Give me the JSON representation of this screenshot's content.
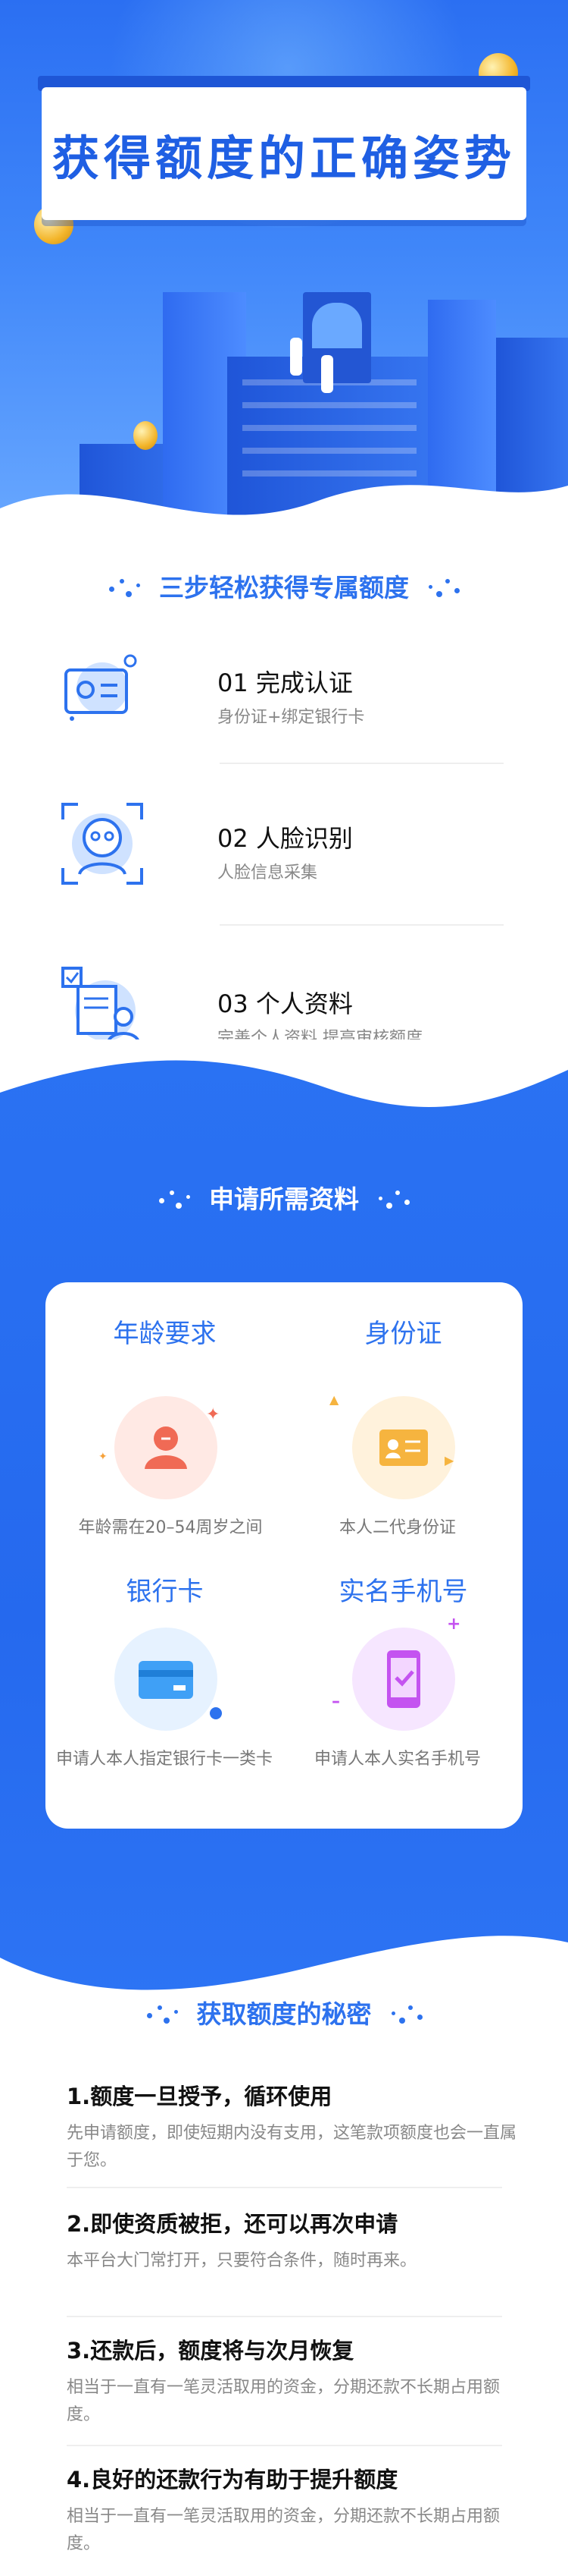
{
  "hero": {
    "title": "获得额度的正确姿势"
  },
  "steps_section": {
    "title": "三步轻松获得专属额度",
    "steps": [
      {
        "title": "01  完成认证",
        "desc": "身份证+绑定银行卡",
        "icon": "id-card-icon"
      },
      {
        "title": "02 人脸识别",
        "desc": "人脸信息采集",
        "icon": "face-scan-icon"
      },
      {
        "title": "03 个人资料",
        "desc": "完善个人资料  提高审核额度",
        "icon": "profile-form-icon"
      }
    ]
  },
  "requirements_section": {
    "title": "申请所需资料",
    "items": [
      {
        "title": "年龄要求",
        "desc": "年龄需在20–54周岁之间",
        "icon": "person-icon"
      },
      {
        "title": "身份证",
        "desc": "本人二代身份证",
        "icon": "id-card-icon"
      },
      {
        "title": "银行卡",
        "desc": "申请人本人指定银行卡一类卡",
        "icon": "bank-card-icon"
      },
      {
        "title": "实名手机号",
        "desc": "申请人本人实名手机号",
        "icon": "phone-check-icon"
      }
    ]
  },
  "secrets_section": {
    "title": "获取额度的秘密",
    "tips": [
      {
        "title": "1.额度一旦授予，循环使用",
        "desc": "先申请额度，即使短期内没有支用，这笔款项额度也会一直属于您。"
      },
      {
        "title": "2.即使资质被拒，还可以再次申请",
        "desc": "本平台大门常打开，只要符合条件，随时再来。"
      },
      {
        "title": "3.还款后，额度将与次月恢复",
        "desc": "相当于一直有一笔灵活取用的资金，分期还款不长期占用额度。"
      },
      {
        "title": "4.良好的还款行为有助于提升额度",
        "desc": "相当于一直有一笔灵活取用的资金，分期还款不长期占用额度。"
      }
    ]
  },
  "colors": {
    "primary": "#2a72f3",
    "title_blue": "#1f5fe3",
    "accent_text": "#2d72ee"
  }
}
